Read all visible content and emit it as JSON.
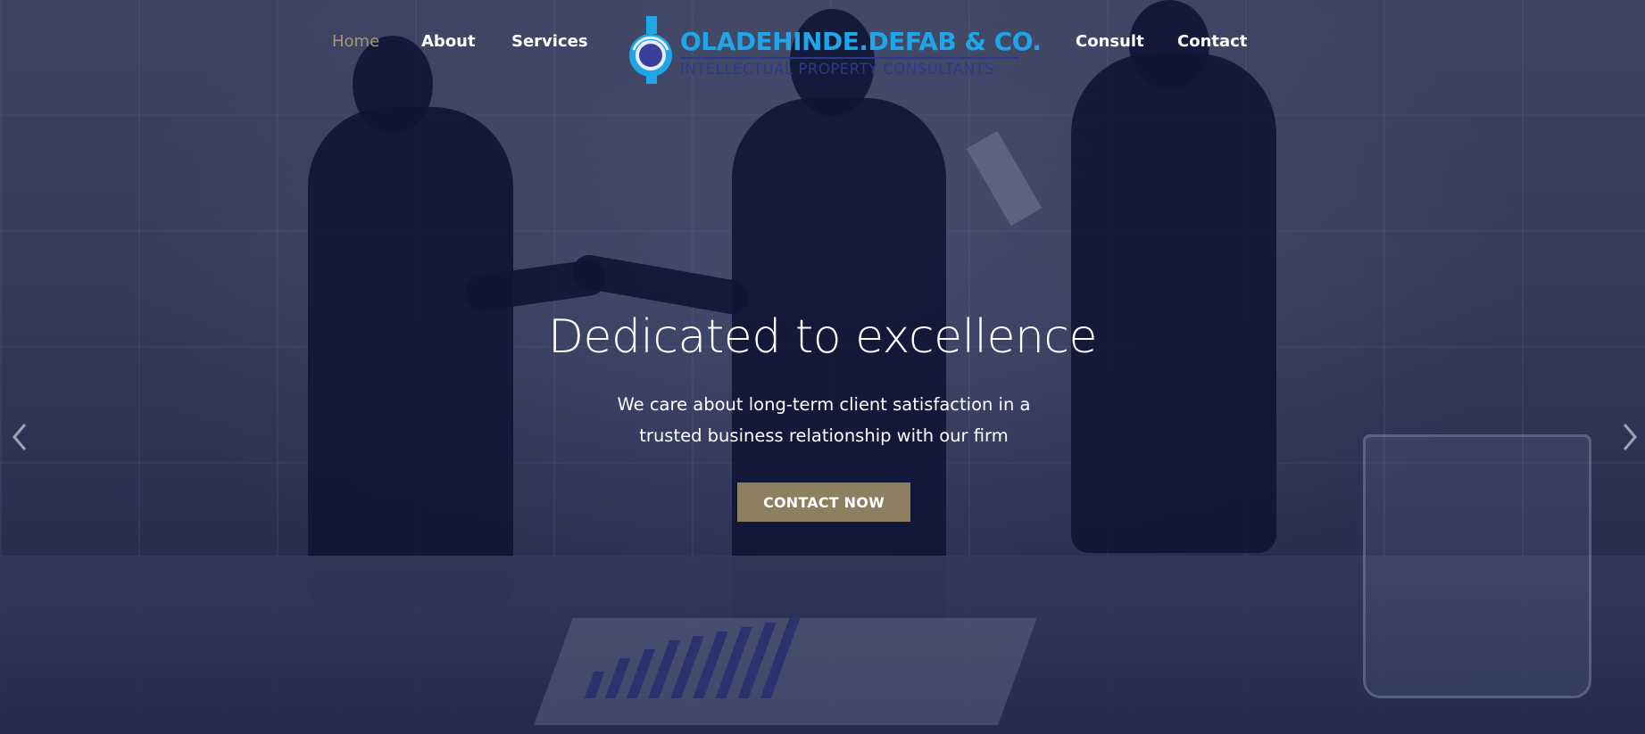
{
  "nav": {
    "left": [
      {
        "label": "Home",
        "active": true
      },
      {
        "label": "About",
        "active": false
      },
      {
        "label": "Services",
        "active": false
      }
    ],
    "right": [
      {
        "label": "Consult",
        "active": false
      },
      {
        "label": "Contact",
        "active": false
      }
    ],
    "active_color": "#a89677"
  },
  "logo": {
    "title": "OLADEHINDE.DEFAB & CO.",
    "subtitle": "INTELLECTUAL PROPERTY CONSULTANTS",
    "title_color": "#1ea6e8",
    "subtitle_color": "#2a3a8a"
  },
  "hero": {
    "headline": "Dedicated to excellence",
    "subtext": "We care about long-term client satisfaction in a trusted business relationship with our firm",
    "cta_label": "CONTACT NOW",
    "cta_color": "#8e7f61",
    "prev_icon": "chevron-left-icon",
    "next_icon": "chevron-right-icon"
  }
}
